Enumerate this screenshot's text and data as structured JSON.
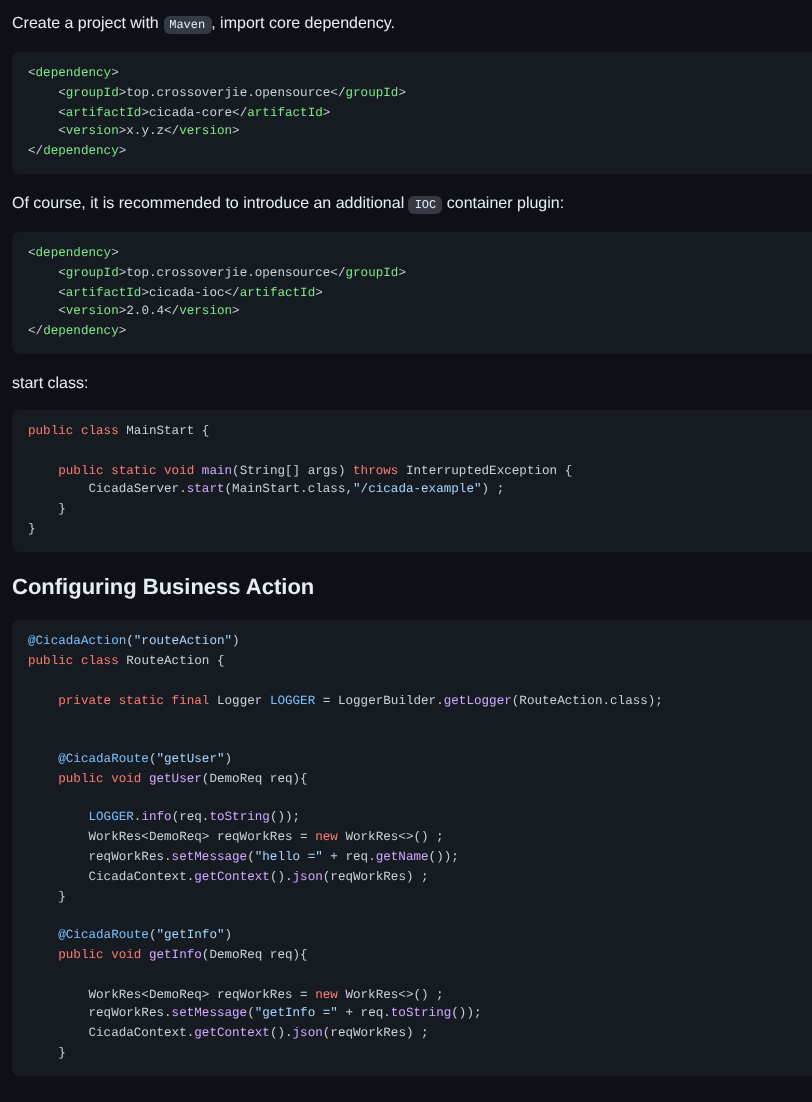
{
  "sections": [
    {
      "kind": "paragraph",
      "parts": [
        {
          "kind": "text",
          "text": "Create a project with "
        },
        {
          "kind": "code",
          "text": "Maven"
        },
        {
          "kind": "text",
          "text": ", import core dependency."
        }
      ]
    },
    {
      "kind": "codeblock",
      "lines": [
        {
          "kind": "code",
          "tokens": [
            {
              "kind": "plain",
              "text": "<"
            },
            {
              "kind": "tag",
              "text": "dependency"
            },
            {
              "kind": "plain",
              "text": ">"
            }
          ]
        },
        {
          "kind": "code",
          "tokens": [
            {
              "kind": "plain",
              "text": "    <"
            },
            {
              "kind": "tag",
              "text": "groupId"
            },
            {
              "kind": "plain",
              "text": ">top.crossoverjie.opensource</"
            },
            {
              "kind": "tag",
              "text": "groupId"
            },
            {
              "kind": "plain",
              "text": ">"
            }
          ]
        },
        {
          "kind": "code",
          "tokens": [
            {
              "kind": "plain",
              "text": "    <"
            },
            {
              "kind": "tag",
              "text": "artifactId"
            },
            {
              "kind": "plain",
              "text": ">cicada-core</"
            },
            {
              "kind": "tag",
              "text": "artifactId"
            },
            {
              "kind": "plain",
              "text": ">"
            }
          ]
        },
        {
          "kind": "code",
          "tokens": [
            {
              "kind": "plain",
              "text": "    <"
            },
            {
              "kind": "tag",
              "text": "version"
            },
            {
              "kind": "plain",
              "text": ">x.y.z</"
            },
            {
              "kind": "tag",
              "text": "version"
            },
            {
              "kind": "plain",
              "text": ">"
            }
          ]
        },
        {
          "kind": "code",
          "tokens": [
            {
              "kind": "plain",
              "text": "</"
            },
            {
              "kind": "tag",
              "text": "dependency"
            },
            {
              "kind": "plain",
              "text": ">"
            }
          ]
        }
      ]
    },
    {
      "kind": "paragraph",
      "parts": [
        {
          "kind": "text",
          "text": "Of course, it is recommended to introduce an additional "
        },
        {
          "kind": "code",
          "text": "IOC"
        },
        {
          "kind": "text",
          "text": " container plugin:"
        }
      ]
    },
    {
      "kind": "codeblock",
      "lines": [
        {
          "kind": "code",
          "tokens": [
            {
              "kind": "plain",
              "text": "<"
            },
            {
              "kind": "tag",
              "text": "dependency"
            },
            {
              "kind": "plain",
              "text": ">"
            }
          ]
        },
        {
          "kind": "code",
          "tokens": [
            {
              "kind": "plain",
              "text": "    <"
            },
            {
              "kind": "tag",
              "text": "groupId"
            },
            {
              "kind": "plain",
              "text": ">top.crossoverjie.opensource</"
            },
            {
              "kind": "tag",
              "text": "groupId"
            },
            {
              "kind": "plain",
              "text": ">"
            }
          ]
        },
        {
          "kind": "code",
          "tokens": [
            {
              "kind": "plain",
              "text": "    <"
            },
            {
              "kind": "tag",
              "text": "artifactId"
            },
            {
              "kind": "plain",
              "text": ">cicada-ioc</"
            },
            {
              "kind": "tag",
              "text": "artifactId"
            },
            {
              "kind": "plain",
              "text": ">"
            }
          ]
        },
        {
          "kind": "code",
          "tokens": [
            {
              "kind": "plain",
              "text": "    <"
            },
            {
              "kind": "tag",
              "text": "version"
            },
            {
              "kind": "plain",
              "text": ">2.0.4</"
            },
            {
              "kind": "tag",
              "text": "version"
            },
            {
              "kind": "plain",
              "text": ">"
            }
          ]
        },
        {
          "kind": "code",
          "tokens": [
            {
              "kind": "plain",
              "text": "</"
            },
            {
              "kind": "tag",
              "text": "dependency"
            },
            {
              "kind": "plain",
              "text": ">"
            }
          ]
        }
      ]
    },
    {
      "kind": "paragraph",
      "parts": [
        {
          "kind": "text",
          "text": "start class:"
        }
      ]
    },
    {
      "kind": "codeblock",
      "lines": [
        {
          "kind": "code",
          "tokens": [
            {
              "kind": "keyword",
              "text": "public class"
            },
            {
              "kind": "plain",
              "text": " MainStart {"
            }
          ]
        },
        {
          "kind": "blank"
        },
        {
          "kind": "code",
          "tokens": [
            {
              "kind": "keyword",
              "text": "    public static void "
            },
            {
              "kind": "function",
              "text": "main"
            },
            {
              "kind": "plain",
              "text": "(String[] args) "
            },
            {
              "kind": "keyword",
              "text": "throws"
            },
            {
              "kind": "plain",
              "text": " InterruptedException {"
            }
          ]
        },
        {
          "kind": "code",
          "tokens": [
            {
              "kind": "plain",
              "text": "        CicadaServer."
            },
            {
              "kind": "function",
              "text": "start"
            },
            {
              "kind": "plain",
              "text": "(MainStart.class,"
            },
            {
              "kind": "string",
              "text": "\"/cicada-example\""
            },
            {
              "kind": "plain",
              "text": ") ;"
            }
          ]
        },
        {
          "kind": "code",
          "tokens": [
            {
              "kind": "plain",
              "text": "    }"
            }
          ]
        },
        {
          "kind": "code",
          "tokens": [
            {
              "kind": "plain",
              "text": "}"
            }
          ]
        }
      ]
    },
    {
      "kind": "heading",
      "text": "Configuring Business Action"
    },
    {
      "kind": "codeblock",
      "lines": [
        {
          "kind": "code",
          "tokens": [
            {
              "kind": "constant",
              "text": "@CicadaAction"
            },
            {
              "kind": "plain",
              "text": "("
            },
            {
              "kind": "string",
              "text": "\"routeAction\""
            },
            {
              "kind": "plain",
              "text": ")"
            }
          ]
        },
        {
          "kind": "code",
          "tokens": [
            {
              "kind": "keyword",
              "text": "public class"
            },
            {
              "kind": "plain",
              "text": " RouteAction {"
            }
          ]
        },
        {
          "kind": "blank"
        },
        {
          "kind": "code",
          "tokens": [
            {
              "kind": "keyword",
              "text": "    private static final"
            },
            {
              "kind": "plain",
              "text": " Logger "
            },
            {
              "kind": "constant",
              "text": "LOGGER"
            },
            {
              "kind": "plain",
              "text": " = LoggerBuilder."
            },
            {
              "kind": "function",
              "text": "getLogger"
            },
            {
              "kind": "plain",
              "text": "(RouteAction.class);"
            }
          ]
        },
        {
          "kind": "blank"
        },
        {
          "kind": "blank"
        },
        {
          "kind": "code",
          "tokens": [
            {
              "kind": "constant",
              "text": "    @CicadaRoute"
            },
            {
              "kind": "plain",
              "text": "("
            },
            {
              "kind": "string",
              "text": "\"getUser\""
            },
            {
              "kind": "plain",
              "text": ")"
            }
          ]
        },
        {
          "kind": "code",
          "tokens": [
            {
              "kind": "keyword",
              "text": "    public void "
            },
            {
              "kind": "function",
              "text": "getUser"
            },
            {
              "kind": "plain",
              "text": "(DemoReq req){"
            }
          ]
        },
        {
          "kind": "blank"
        },
        {
          "kind": "code",
          "tokens": [
            {
              "kind": "constant",
              "text": "        LOGGER"
            },
            {
              "kind": "plain",
              "text": "."
            },
            {
              "kind": "function",
              "text": "info"
            },
            {
              "kind": "plain",
              "text": "(req."
            },
            {
              "kind": "function",
              "text": "toString"
            },
            {
              "kind": "plain",
              "text": "());"
            }
          ]
        },
        {
          "kind": "code",
          "tokens": [
            {
              "kind": "plain",
              "text": "        WorkRes<DemoReq> reqWorkRes = "
            },
            {
              "kind": "keyword",
              "text": "new"
            },
            {
              "kind": "plain",
              "text": " WorkRes<>() ;"
            }
          ]
        },
        {
          "kind": "code",
          "tokens": [
            {
              "kind": "plain",
              "text": "        reqWorkRes."
            },
            {
              "kind": "function",
              "text": "setMessage"
            },
            {
              "kind": "plain",
              "text": "("
            },
            {
              "kind": "string",
              "text": "\"hello =\""
            },
            {
              "kind": "plain",
              "text": " + req."
            },
            {
              "kind": "function",
              "text": "getName"
            },
            {
              "kind": "plain",
              "text": "());"
            }
          ]
        },
        {
          "kind": "code",
          "tokens": [
            {
              "kind": "plain",
              "text": "        CicadaContext."
            },
            {
              "kind": "function",
              "text": "getContext"
            },
            {
              "kind": "plain",
              "text": "()."
            },
            {
              "kind": "function",
              "text": "json"
            },
            {
              "kind": "plain",
              "text": "(reqWorkRes) ;"
            }
          ]
        },
        {
          "kind": "code",
          "tokens": [
            {
              "kind": "plain",
              "text": "    }"
            }
          ]
        },
        {
          "kind": "blank"
        },
        {
          "kind": "code",
          "tokens": [
            {
              "kind": "constant",
              "text": "    @CicadaRoute"
            },
            {
              "kind": "plain",
              "text": "("
            },
            {
              "kind": "string",
              "text": "\"getInfo\""
            },
            {
              "kind": "plain",
              "text": ")"
            }
          ]
        },
        {
          "kind": "code",
          "tokens": [
            {
              "kind": "keyword",
              "text": "    public void "
            },
            {
              "kind": "function",
              "text": "getInfo"
            },
            {
              "kind": "plain",
              "text": "(DemoReq req){"
            }
          ]
        },
        {
          "kind": "blank"
        },
        {
          "kind": "code",
          "tokens": [
            {
              "kind": "plain",
              "text": "        WorkRes<DemoReq> reqWorkRes = "
            },
            {
              "kind": "keyword",
              "text": "new"
            },
            {
              "kind": "plain",
              "text": " WorkRes<>() ;"
            }
          ]
        },
        {
          "kind": "code",
          "tokens": [
            {
              "kind": "plain",
              "text": "        reqWorkRes."
            },
            {
              "kind": "function",
              "text": "setMessage"
            },
            {
              "kind": "plain",
              "text": "("
            },
            {
              "kind": "string",
              "text": "\"getInfo =\""
            },
            {
              "kind": "plain",
              "text": " + req."
            },
            {
              "kind": "function",
              "text": "toString"
            },
            {
              "kind": "plain",
              "text": "());"
            }
          ]
        },
        {
          "kind": "code",
          "tokens": [
            {
              "kind": "plain",
              "text": "        CicadaContext."
            },
            {
              "kind": "function",
              "text": "getContext"
            },
            {
              "kind": "plain",
              "text": "()."
            },
            {
              "kind": "function",
              "text": "json"
            },
            {
              "kind": "plain",
              "text": "(reqWorkRes) ;"
            }
          ]
        },
        {
          "kind": "code",
          "tokens": [
            {
              "kind": "plain",
              "text": "    }"
            }
          ]
        }
      ]
    }
  ]
}
